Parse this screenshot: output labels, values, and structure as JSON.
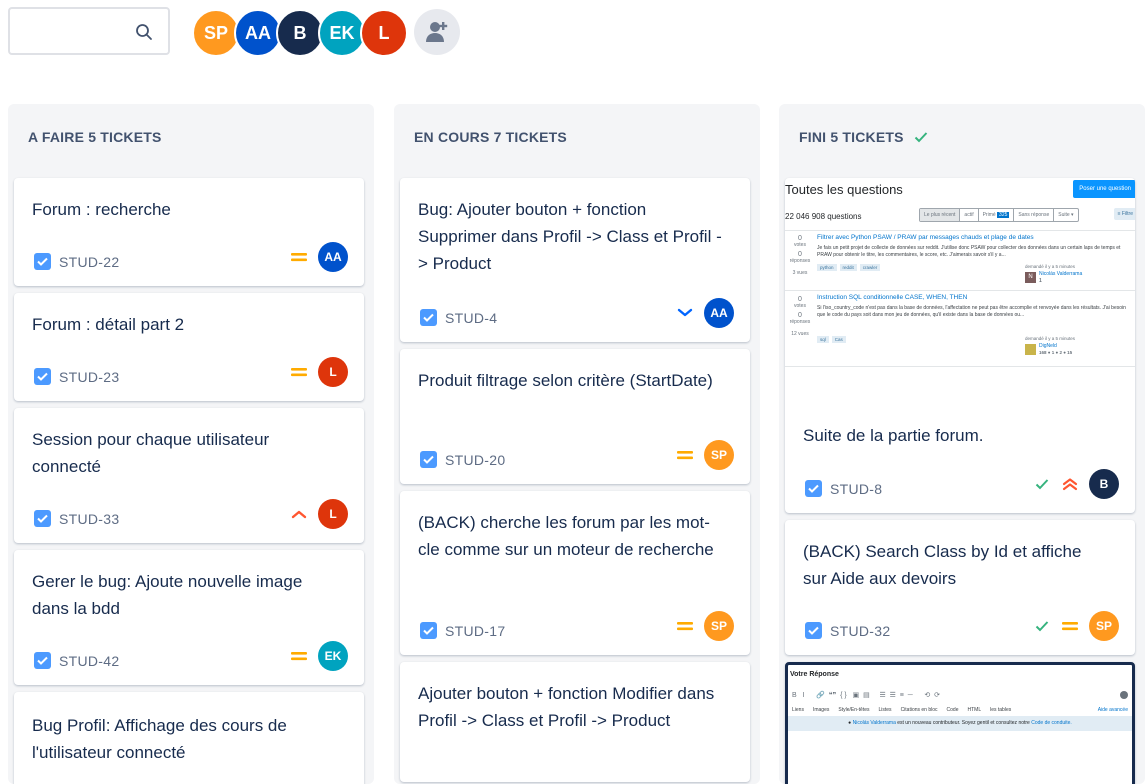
{
  "search": {
    "placeholder": ""
  },
  "members": [
    {
      "initials": "SP",
      "color": "#ff991f"
    },
    {
      "initials": "AA",
      "color": "#0052cc"
    },
    {
      "initials": "B",
      "color": "#172b4d"
    },
    {
      "initials": "EK",
      "color": "#00a3bf"
    },
    {
      "initials": "L",
      "color": "#de350b"
    }
  ],
  "columns": [
    {
      "label": "A FAIRE 5 TICKETS",
      "cards": [
        {
          "title": "Forum : recherche",
          "key": "STUD-22",
          "priority": "medium",
          "assignee": "AA"
        },
        {
          "title": "Forum : détail part 2",
          "key": "STUD-23",
          "priority": "medium",
          "assignee": "L"
        },
        {
          "title": "Session pour chaque utilisateur connecté",
          "key": "STUD-33",
          "priority": "high",
          "assignee": "L"
        },
        {
          "title": "Gerer le bug: Ajoute nouvelle image dans la bdd",
          "key": "STUD-42",
          "priority": "medium",
          "assignee": "EK"
        },
        {
          "title": "Bug Profil: Affichage des cours de l'utilisateur connecté",
          "key": "",
          "priority": "",
          "assignee": ""
        }
      ]
    },
    {
      "label": "EN COURS 7 TICKETS",
      "cards": [
        {
          "title": "Bug: Ajouter bouton + fonction Supprimer dans Profil -> Class et Profil -> Product",
          "key": "STUD-4",
          "priority": "low",
          "assignee": "AA"
        },
        {
          "title": "Produit filtrage selon critère (StartDate)",
          "key": "STUD-20",
          "priority": "medium",
          "assignee": "SP"
        },
        {
          "title": "(BACK) cherche les forum par les mot-cle comme sur un moteur de recherche",
          "key": "STUD-17",
          "priority": "medium",
          "assignee": "SP"
        },
        {
          "title": "Ajouter bouton + fonction Modifier dans Profil -> Class et Profil -> Product",
          "key": "",
          "priority": "",
          "assignee": ""
        }
      ]
    },
    {
      "label": "FINI 5 TICKETS",
      "cards": [
        {
          "title": "Suite de la partie forum.",
          "key": "STUD-8",
          "priority": "highest",
          "assignee": "B"
        },
        {
          "title": "(BACK) Search Class by Id et affiche sur Aide aux devoirs",
          "key": "STUD-32",
          "priority": "medium",
          "assignee": "SP"
        }
      ]
    }
  ],
  "preview1": {
    "heading": "Toutes les questions",
    "ask": "Poser une question",
    "count": "22 046 908 questions",
    "tabs": [
      "Le plus récent",
      "actif",
      "Primé",
      "Sans réponse",
      "Suite ▾"
    ],
    "bounty": "325",
    "filter": "Filtre",
    "q1_title": "Filtrer avec Python PSAW / PRAW par messages chauds et plage de dates",
    "q1_body": "Je fais un petit projet de collecte de données sur reddit. J'utilise donc PSAW pour collecter des données dans un certain laps de temps et PRAW pour obtenir le titre, les commentaires, le score, etc. J'aimerais savoir s'il y a...",
    "q1_tags": [
      "python",
      "reddit",
      "crawler"
    ],
    "q1_asked": "demandé il y a 5 minutes",
    "q1_user": "Nicolás Valderrama",
    "q1_rep": "1",
    "q1_votes": "0",
    "q1_answers": "0",
    "q1_views": "3 vues",
    "q2_title": "Instruction SQL conditionnelle CASE, WHEN, THEN",
    "q2_body": "Si l'iso_country_code n'est pas dans la base de données, l'affectation ne peut pas être accomplie et renvoyée dans les résultats. J'ai besoin que le code du pays soit dans mon jeu de données, qu'il existe dans la base de données ou...",
    "q2_tags": [
      "sql",
      "Cas"
    ],
    "q2_asked": "demandé il y a 5 minutes",
    "q2_user": "DigNeld",
    "q2_rep": "168 ● 1 ● 2 ● 15",
    "q2_votes": "0",
    "q2_answers": "0",
    "q2_views": "12 vues",
    "votes_label": "votes",
    "answers_label": "réponses",
    "avatar_letter": "N"
  },
  "preview2": {
    "heading": "Votre Réponse",
    "toolbar": "B   I      🔗  ❝❞  { }   ▣  ▤     ☰  ☰  ≡  ─      ⟲  ⟳",
    "menu": [
      "Liens",
      "Images",
      "Style/En-têtes",
      "Listes",
      "Citations en bloc",
      "Code",
      "HTML",
      "les tables"
    ],
    "advanced": "Aide avancée",
    "notice_user": "Nicolás Valderrama",
    "notice_text": " est un nouveau contributeur. Soyez gentil et consultez notre ",
    "notice_link": "Code de conduite."
  }
}
